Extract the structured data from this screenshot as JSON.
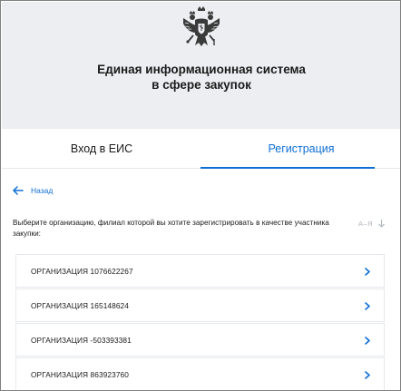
{
  "header": {
    "title_line1": "Единая информационная система",
    "title_line2": "в сфере закупок"
  },
  "tabs": [
    {
      "label": "Вход в ЕИС",
      "active": false
    },
    {
      "label": "Регистрация",
      "active": true
    }
  ],
  "back": {
    "label": "Назад"
  },
  "instruction": "Выберите организацию, филиал которой вы хотите зарегистрировать в качестве участника закупки:",
  "sort": {
    "label": "А–Я"
  },
  "organizations": [
    {
      "name": "ОРГАНИЗАЦИЯ 1076622267"
    },
    {
      "name": "ОРГАНИЗАЦИЯ 165148624"
    },
    {
      "name": "ОРГАНИЗАЦИЯ -503393381"
    },
    {
      "name": "ОРГАНИЗАЦИЯ 863923760"
    }
  ],
  "colors": {
    "accent": "#0d6ed6",
    "header_bg": "#eceef1",
    "border": "#e5e8ec",
    "muted": "#b0b6bd"
  },
  "icons": {
    "emblem": "double-headed-eagle-emblem",
    "back": "arrow-left-icon",
    "sort": "arrow-down-icon",
    "row": "chevron-right-icon"
  }
}
